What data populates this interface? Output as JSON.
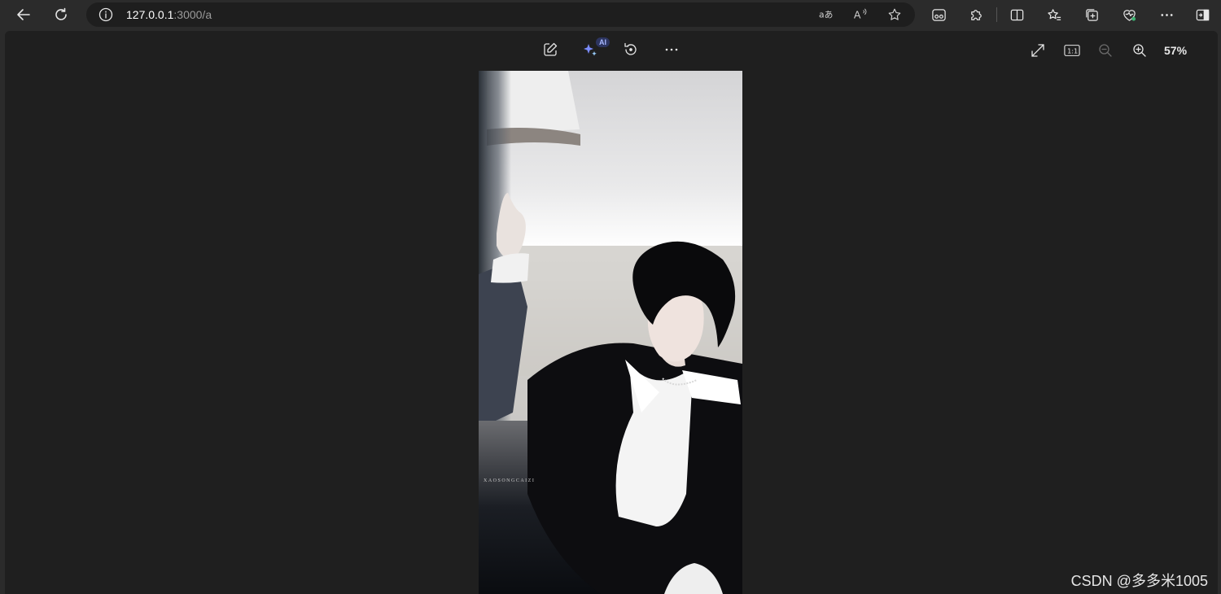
{
  "browser": {
    "url_host": "127.0.0.1",
    "url_path": ":3000/a",
    "icons": {
      "back": "back-arrow-icon",
      "refresh": "refresh-icon",
      "site_info": "info-icon",
      "translate": "translate-icon",
      "read_aloud": "read-aloud-icon",
      "favorite": "star-icon",
      "toolbar": [
        "reading-glasses-icon",
        "puzzle-extension-icon",
        "split-screen-icon",
        "favorites-icon",
        "collections-icon",
        "browser-essentials-icon",
        "more-dots-icon",
        "sidebar-toggle-icon"
      ]
    }
  },
  "viewer": {
    "ai_badge": "AI",
    "zoom_level": "57%",
    "icons": {
      "edit": "edit-image-icon",
      "ai": "sparkle-ai-icon",
      "rotate": "rotate-icon",
      "more": "more-dots-icon",
      "fit": "expand-icon",
      "actual_size": "one-to-one-icon",
      "zoom_out": "zoom-out-icon",
      "zoom_in": "zoom-in-icon"
    },
    "image_caption": "XAOSONGCAIZI"
  },
  "watermark": "CSDN @多多米1005",
  "colors": {
    "chrome_bg": "#2b2b2b",
    "address_bg": "#1e1e1e",
    "viewer_bg": "#1f1f1f",
    "ai_accent": "#7b8cff"
  }
}
